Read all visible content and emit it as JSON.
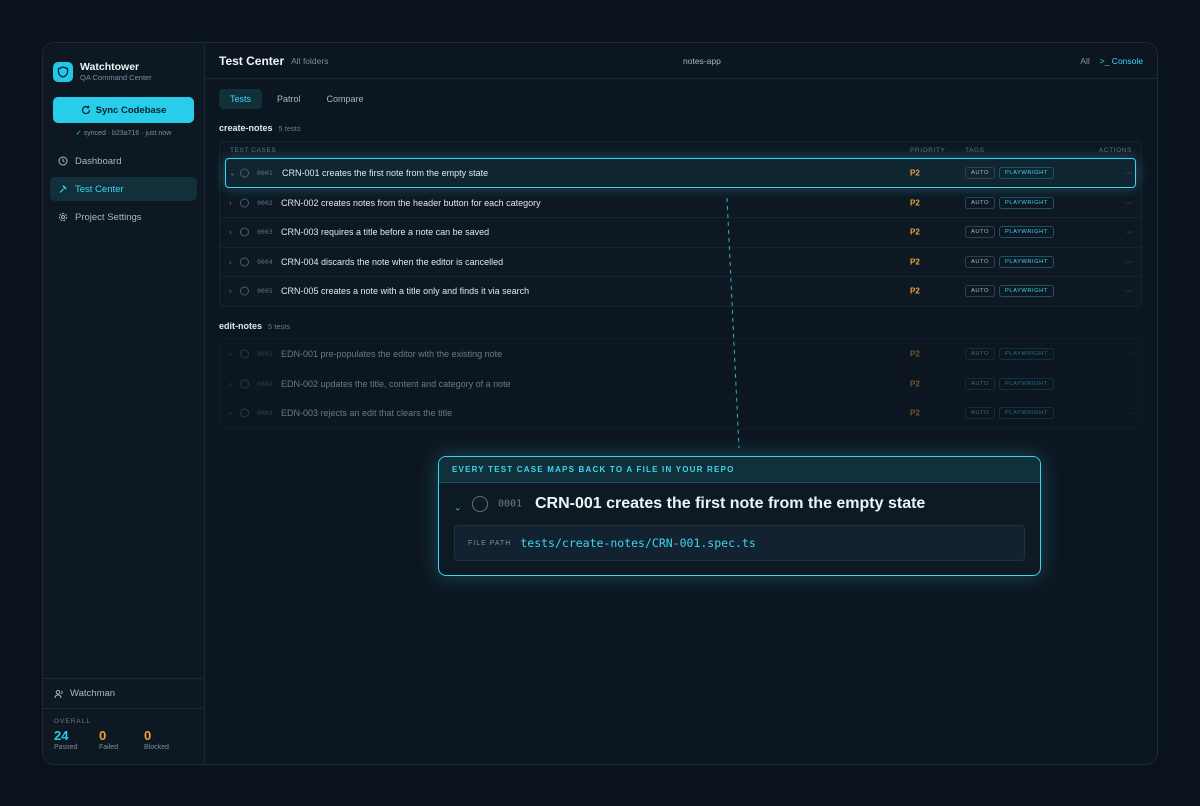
{
  "brand": {
    "title": "Watchtower",
    "subtitle": "QA Command Center"
  },
  "sidebar": {
    "sync_label": "Sync Codebase",
    "sync_status": "synced · b23a716 · just now",
    "items": [
      {
        "label": "Dashboard",
        "icon": "clock-icon"
      },
      {
        "label": "Test Center",
        "icon": "wrench-icon"
      },
      {
        "label": "Project Settings",
        "icon": "gear-icon"
      }
    ],
    "user": "Watchman",
    "stats_label": "OVERALL",
    "stats": [
      {
        "value": "24",
        "label": "Passed",
        "color": "#27cde9"
      },
      {
        "value": "0",
        "label": "Failed",
        "color": "#f0a23a"
      },
      {
        "value": "0",
        "label": "Blocked",
        "color": "#f0a23a"
      }
    ]
  },
  "header": {
    "title": "Test Center",
    "subtitle": "All folders",
    "project": "notes-app",
    "filter": "All",
    "console": ">_ Console"
  },
  "tabs": [
    "Tests",
    "Patrol",
    "Compare"
  ],
  "columns": {
    "cases": "TEST CASES",
    "priority": "PRIORITY",
    "tags": "TAGS",
    "actions": "ACTIONS"
  },
  "groups": [
    {
      "name": "create-notes",
      "count": "5 tests",
      "rows": [
        {
          "chev": "⌄",
          "id": "0001",
          "title": "CRN-001 creates the first note from the empty state",
          "priority": "P2",
          "tag1": "AUTO",
          "tag2": "PLAYWRIGHT"
        },
        {
          "chev": "›",
          "id": "0002",
          "title": "CRN-002 creates notes from the header button for each category",
          "priority": "P2",
          "tag1": "AUTO",
          "tag2": "PLAYWRIGHT"
        },
        {
          "chev": "›",
          "id": "0003",
          "title": "CRN-003 requires a title before a note can be saved",
          "priority": "P2",
          "tag1": "AUTO",
          "tag2": "PLAYWRIGHT"
        },
        {
          "chev": "›",
          "id": "0004",
          "title": "CRN-004 discards the note when the editor is cancelled",
          "priority": "P2",
          "tag1": "AUTO",
          "tag2": "PLAYWRIGHT"
        },
        {
          "chev": "›",
          "id": "0005",
          "title": "CRN-005 creates a note with a title only and finds it via search",
          "priority": "P2",
          "tag1": "AUTO",
          "tag2": "PLAYWRIGHT"
        }
      ]
    },
    {
      "name": "edit-notes",
      "count": "5 tests",
      "rows": [
        {
          "chev": "›",
          "id": "0001",
          "title": "EDN-001 pre-populates the editor with the existing note",
          "priority": "P2",
          "tag1": "AUTO",
          "tag2": "PLAYWRIGHT"
        },
        {
          "chev": "›",
          "id": "0002",
          "title": "EDN-002 updates the title, content and category of a note",
          "priority": "P2",
          "tag1": "AUTO",
          "tag2": "PLAYWRIGHT"
        },
        {
          "chev": "›",
          "id": "0003",
          "title": "EDN-003 rejects an edit that clears the title",
          "priority": "P2",
          "tag1": "AUTO",
          "tag2": "PLAYWRIGHT"
        }
      ]
    }
  ],
  "more_glyph": "···",
  "callout": {
    "heading": "EVERY TEST CASE MAPS BACK TO A FILE IN YOUR REPO",
    "chev": "⌄",
    "id": "0001",
    "title": "CRN-001 creates the first note from the empty state",
    "file_label": "FILE PATH",
    "file_path": "tests/create-notes/CRN-001.spec.ts"
  },
  "colors": {
    "accent": "#3fd4ef",
    "warning": "#f0a23a",
    "background": "#0a121c"
  }
}
